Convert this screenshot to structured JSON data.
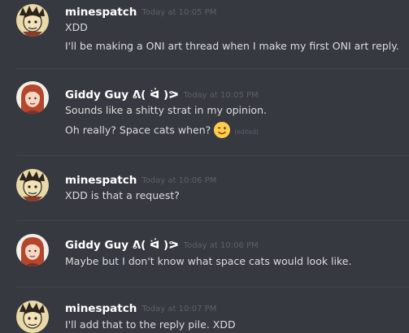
{
  "messages": [
    {
      "author": "minespatch",
      "timestamp": "Today at 10:05 PM",
      "lines": [
        "XDD",
        "I'll be making a ONI art thread when I make my first ONI art reply."
      ]
    },
    {
      "author": "Giddy Guy ᕕ( ᐛ )ᕗ",
      "timestamp": "Today at 10:05 PM",
      "lines": [
        "Sounds like a shitty strat in my opinion.",
        "Oh really? Space cats when?"
      ],
      "edited_label": "(edited)",
      "emoji": "winking-face"
    },
    {
      "author": "minespatch",
      "timestamp": "Today at 10:06 PM",
      "lines": [
        "XDD is that a request?"
      ]
    },
    {
      "author": "Giddy Guy ᕕ( ᐛ )ᕗ",
      "timestamp": "Today at 10:06 PM",
      "lines": [
        "Maybe but I don't know what space cats would look like."
      ]
    },
    {
      "author": "minespatch",
      "timestamp": "Today at 10:07 PM",
      "lines": [
        "I'll add that to the reply pile. XDD"
      ]
    }
  ],
  "colors": {
    "background": "#36393f",
    "divider": "#42454a",
    "username": "#ffffff",
    "timestamp": "#5d6066",
    "text": "#dcddde"
  }
}
